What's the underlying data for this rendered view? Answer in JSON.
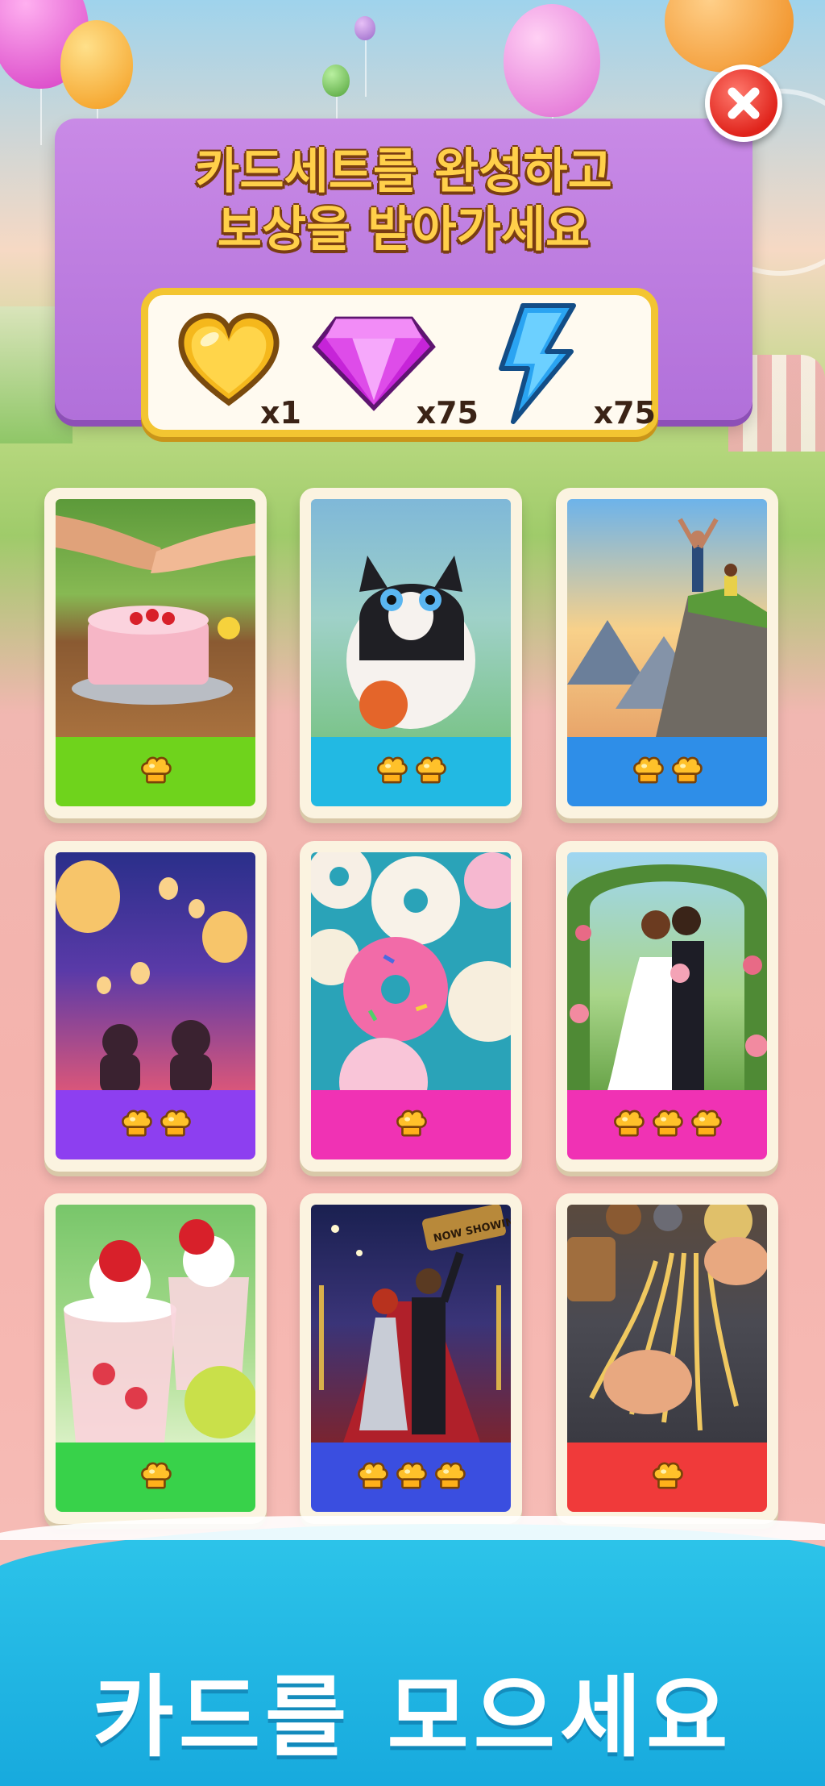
{
  "panel": {
    "title_line1": "카드세트를 완성하고",
    "title_line2": "보상을 받아가세요"
  },
  "rewards": [
    {
      "icon": "golden-heart-icon",
      "amount": "x1"
    },
    {
      "icon": "pink-gem-icon",
      "amount": "x75"
    },
    {
      "icon": "lightning-bolt-icon",
      "amount": "x75"
    }
  ],
  "close_button": {
    "icon": "close-icon"
  },
  "cards": [
    {
      "scene": "handshake-cake",
      "band_color": "#6fd31c",
      "stars": 1
    },
    {
      "scene": "cat-with-ball",
      "band_color": "#22b9e3",
      "stars": 2
    },
    {
      "scene": "mountain-hikers",
      "band_color": "#2e8ee8",
      "stars": 2
    },
    {
      "scene": "sky-lanterns",
      "band_color": "#8d3ff0",
      "stars": 2
    },
    {
      "scene": "donuts",
      "band_color": "#f032b4",
      "stars": 1
    },
    {
      "scene": "wedding-kiss",
      "band_color": "#f032b4",
      "stars": 3
    },
    {
      "scene": "strawberry-desserts",
      "band_color": "#38d24a",
      "stars": 1
    },
    {
      "scene": "red-carpet-couple",
      "band_color": "#3a4ee0",
      "stars": 3,
      "sign_text": "NOW SHOWING"
    },
    {
      "scene": "noodle-making",
      "band_color": "#f03a3a",
      "stars": 1
    }
  ],
  "tagline": "카드를 모으세요"
}
